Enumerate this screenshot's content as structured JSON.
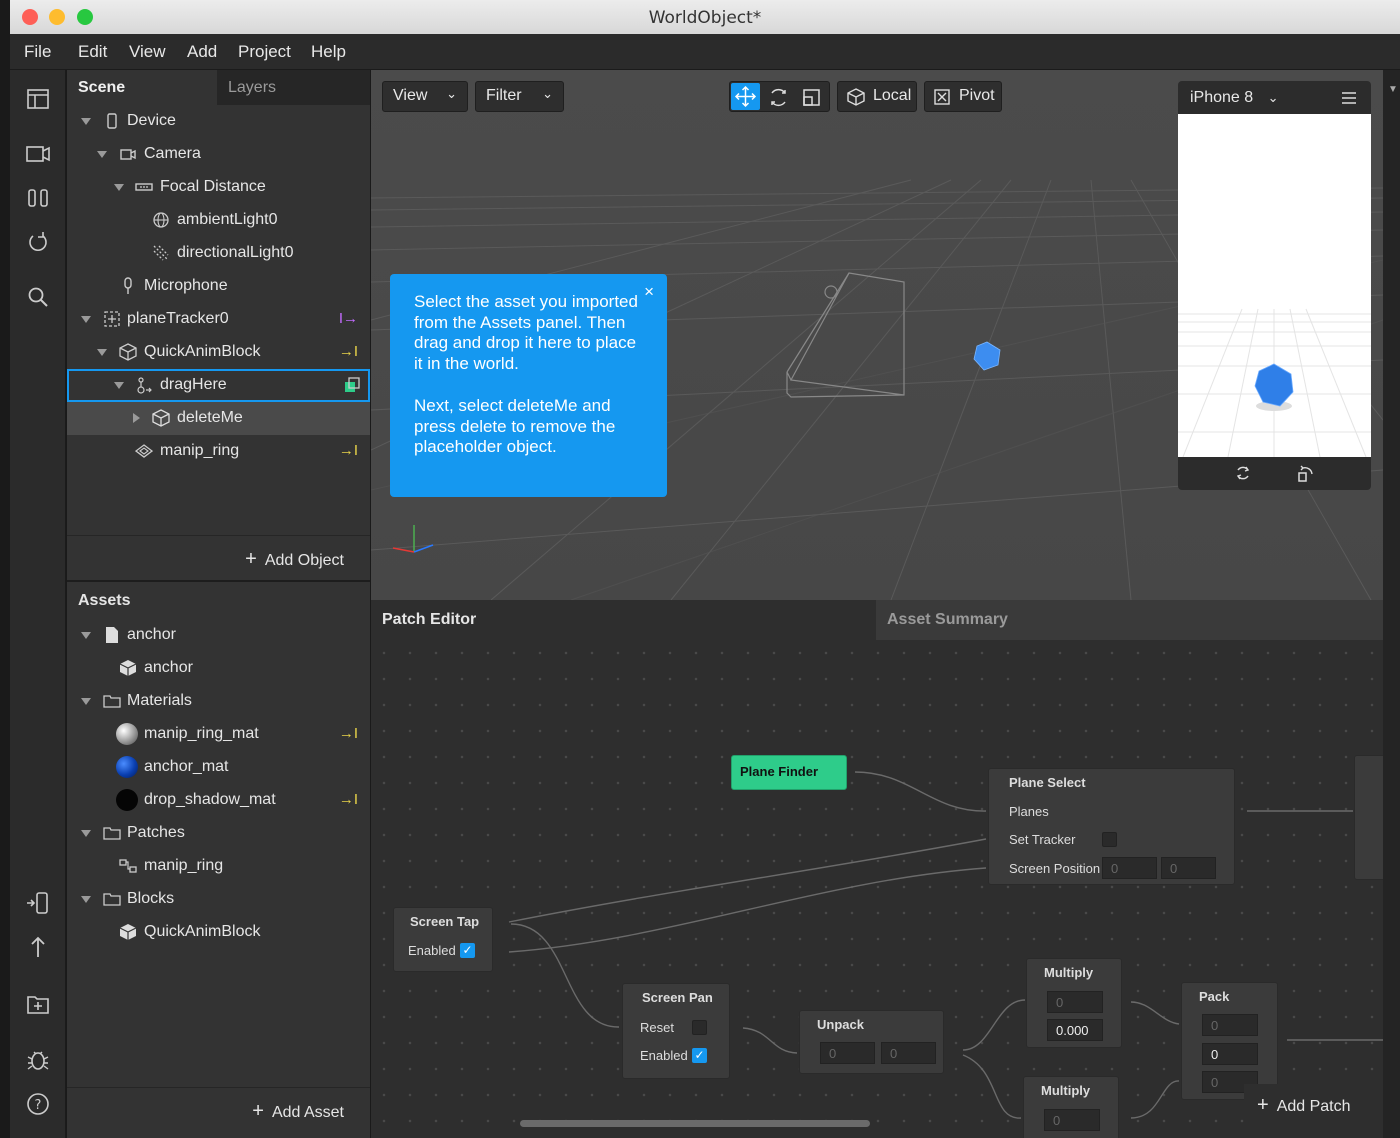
{
  "window": {
    "title": "WorldObject*"
  },
  "menu": [
    "File",
    "Edit",
    "View",
    "Add",
    "Project",
    "Help"
  ],
  "scene": {
    "tabs": [
      "Scene",
      "Layers"
    ],
    "items": [
      {
        "label": "Device"
      },
      {
        "label": "Camera"
      },
      {
        "label": "Focal Distance"
      },
      {
        "label": "ambientLight0"
      },
      {
        "label": "directionalLight0"
      },
      {
        "label": "Microphone"
      },
      {
        "label": "planeTracker0"
      },
      {
        "label": "QuickAnimBlock"
      },
      {
        "label": "dragHere"
      },
      {
        "label": "deleteMe"
      },
      {
        "label": "manip_ring"
      }
    ],
    "add_object": "Add Object"
  },
  "assets": {
    "title": "Assets",
    "items": [
      {
        "label": "anchor"
      },
      {
        "label": "anchor"
      },
      {
        "label": "Materials"
      },
      {
        "label": "manip_ring_mat"
      },
      {
        "label": "anchor_mat"
      },
      {
        "label": "drop_shadow_mat"
      },
      {
        "label": "Patches"
      },
      {
        "label": "manip_ring"
      },
      {
        "label": "Blocks"
      },
      {
        "label": "QuickAnimBlock"
      }
    ],
    "add_asset": "Add Asset"
  },
  "viewport": {
    "view_label": "View",
    "filter_label": "Filter",
    "local_label": "Local",
    "pivot_label": "Pivot"
  },
  "tooltip": {
    "paragraph1": "Select the asset you imported from the Assets panel. Then drag and drop it here to place it in the world.",
    "paragraph2": "Next, select deleteMe and press delete to remove the placeholder object.",
    "close": "×"
  },
  "device": {
    "label": "iPhone 8"
  },
  "patch_editor": {
    "tabs": [
      "Patch Editor",
      "Asset Summary"
    ],
    "add_patch": "Add Patch",
    "nodes": {
      "plane_finder": {
        "title": "Plane Finder"
      },
      "plane_select": {
        "title": "Plane Select",
        "planes": "Planes",
        "set_tracker": "Set Tracker",
        "screen_position": "Screen Position",
        "x": "0",
        "y": "0"
      },
      "screen_tap": {
        "title": "Screen Tap",
        "enabled": "Enabled"
      },
      "screen_pan": {
        "title": "Screen Pan",
        "reset": "Reset",
        "enabled": "Enabled"
      },
      "unpack": {
        "title": "Unpack",
        "x": "0",
        "y": "0"
      },
      "multiply1": {
        "title": "Multiply",
        "a": "0",
        "b": "0.000"
      },
      "multiply2": {
        "title": "Multiply",
        "a": "0"
      },
      "pack": {
        "title": "Pack",
        "a": "0",
        "b": "0",
        "c": "0"
      }
    }
  },
  "colors": {
    "accent": "#1598f0",
    "patch_green": "#2ecc8a",
    "action_yellow": "#e8d34a",
    "action_purple": "#c36bff"
  }
}
